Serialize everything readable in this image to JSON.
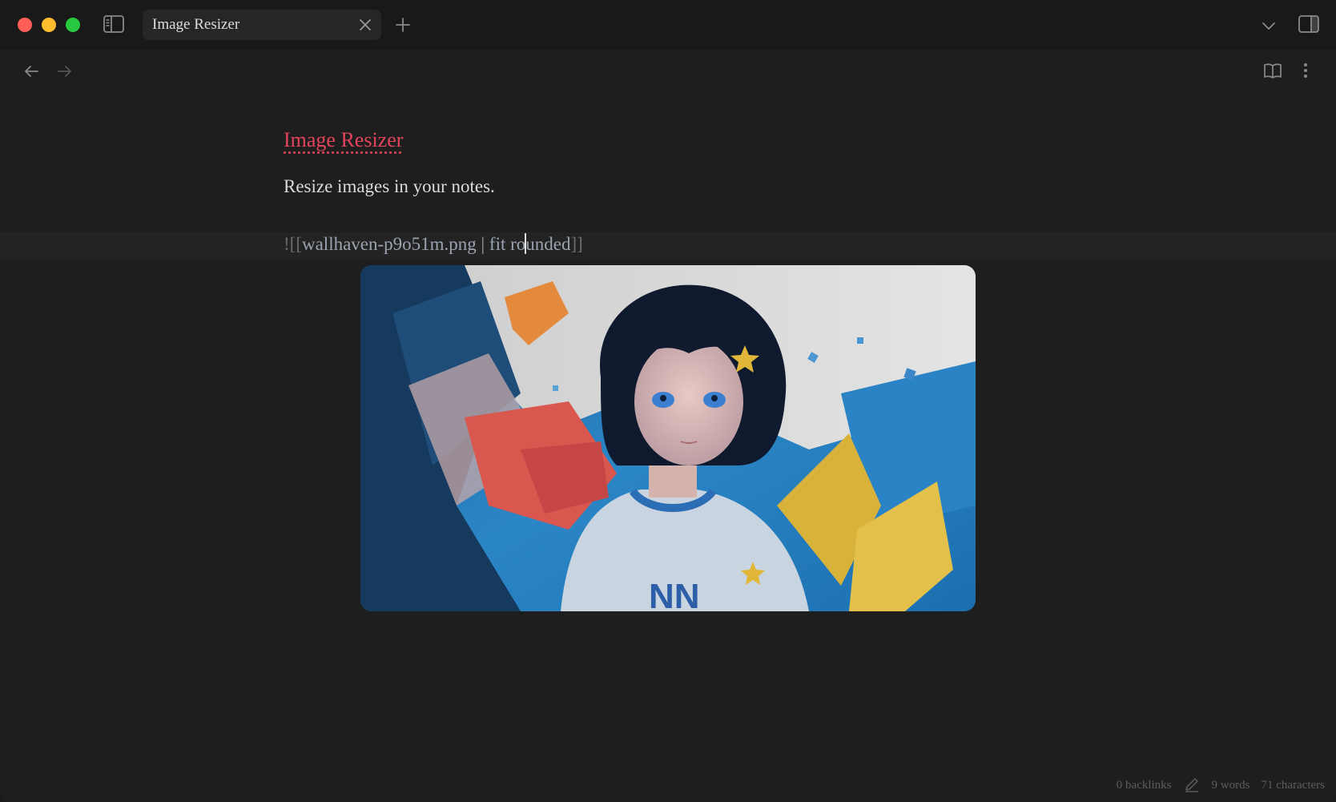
{
  "tab": {
    "title": "Image Resizer"
  },
  "note": {
    "title": "Image Resizer",
    "body": "Resize images in your notes.",
    "embed": {
      "open": "![[",
      "link_before_cursor": "wallhaven-p9o51m.png | fit ro",
      "link_after_cursor": "unded",
      "close": "]]"
    }
  },
  "statusbar": {
    "backlinks": "0 backlinks",
    "words": "9 words",
    "characters": "71 characters"
  },
  "icons": {
    "sidebar_toggle": "sidebar-left-icon",
    "tab_close": "close-icon",
    "new_tab": "plus-icon",
    "tab_list": "chevron-down-icon",
    "right_sidebar": "sidebar-right-icon",
    "back": "arrow-left-icon",
    "forward": "arrow-right-icon",
    "reading_view": "book-open-icon",
    "more": "more-vertical-icon",
    "edit": "pencil-icon"
  },
  "colors": {
    "title_accent": "#e2445c",
    "traffic_red": "#ff5f57",
    "traffic_yellow": "#febc2e",
    "traffic_green": "#28c840"
  }
}
